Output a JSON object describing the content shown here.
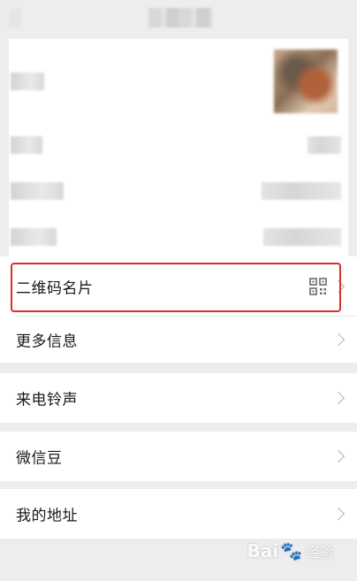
{
  "menu": {
    "qr_code": "二维码名片",
    "more_info": "更多信息",
    "ringtone": "来电铃声",
    "wechat_bean": "微信豆",
    "my_address": "我的地址"
  },
  "icons": {
    "qr": "qr-code-icon",
    "chevron": "chevron-right-icon"
  },
  "watermark": {
    "brand": "Bai",
    "paw": "🐾",
    "brand_end": "",
    "sub": "经验"
  },
  "colors": {
    "highlight": "#d93025",
    "background": "#ededed",
    "row": "#ffffff"
  }
}
